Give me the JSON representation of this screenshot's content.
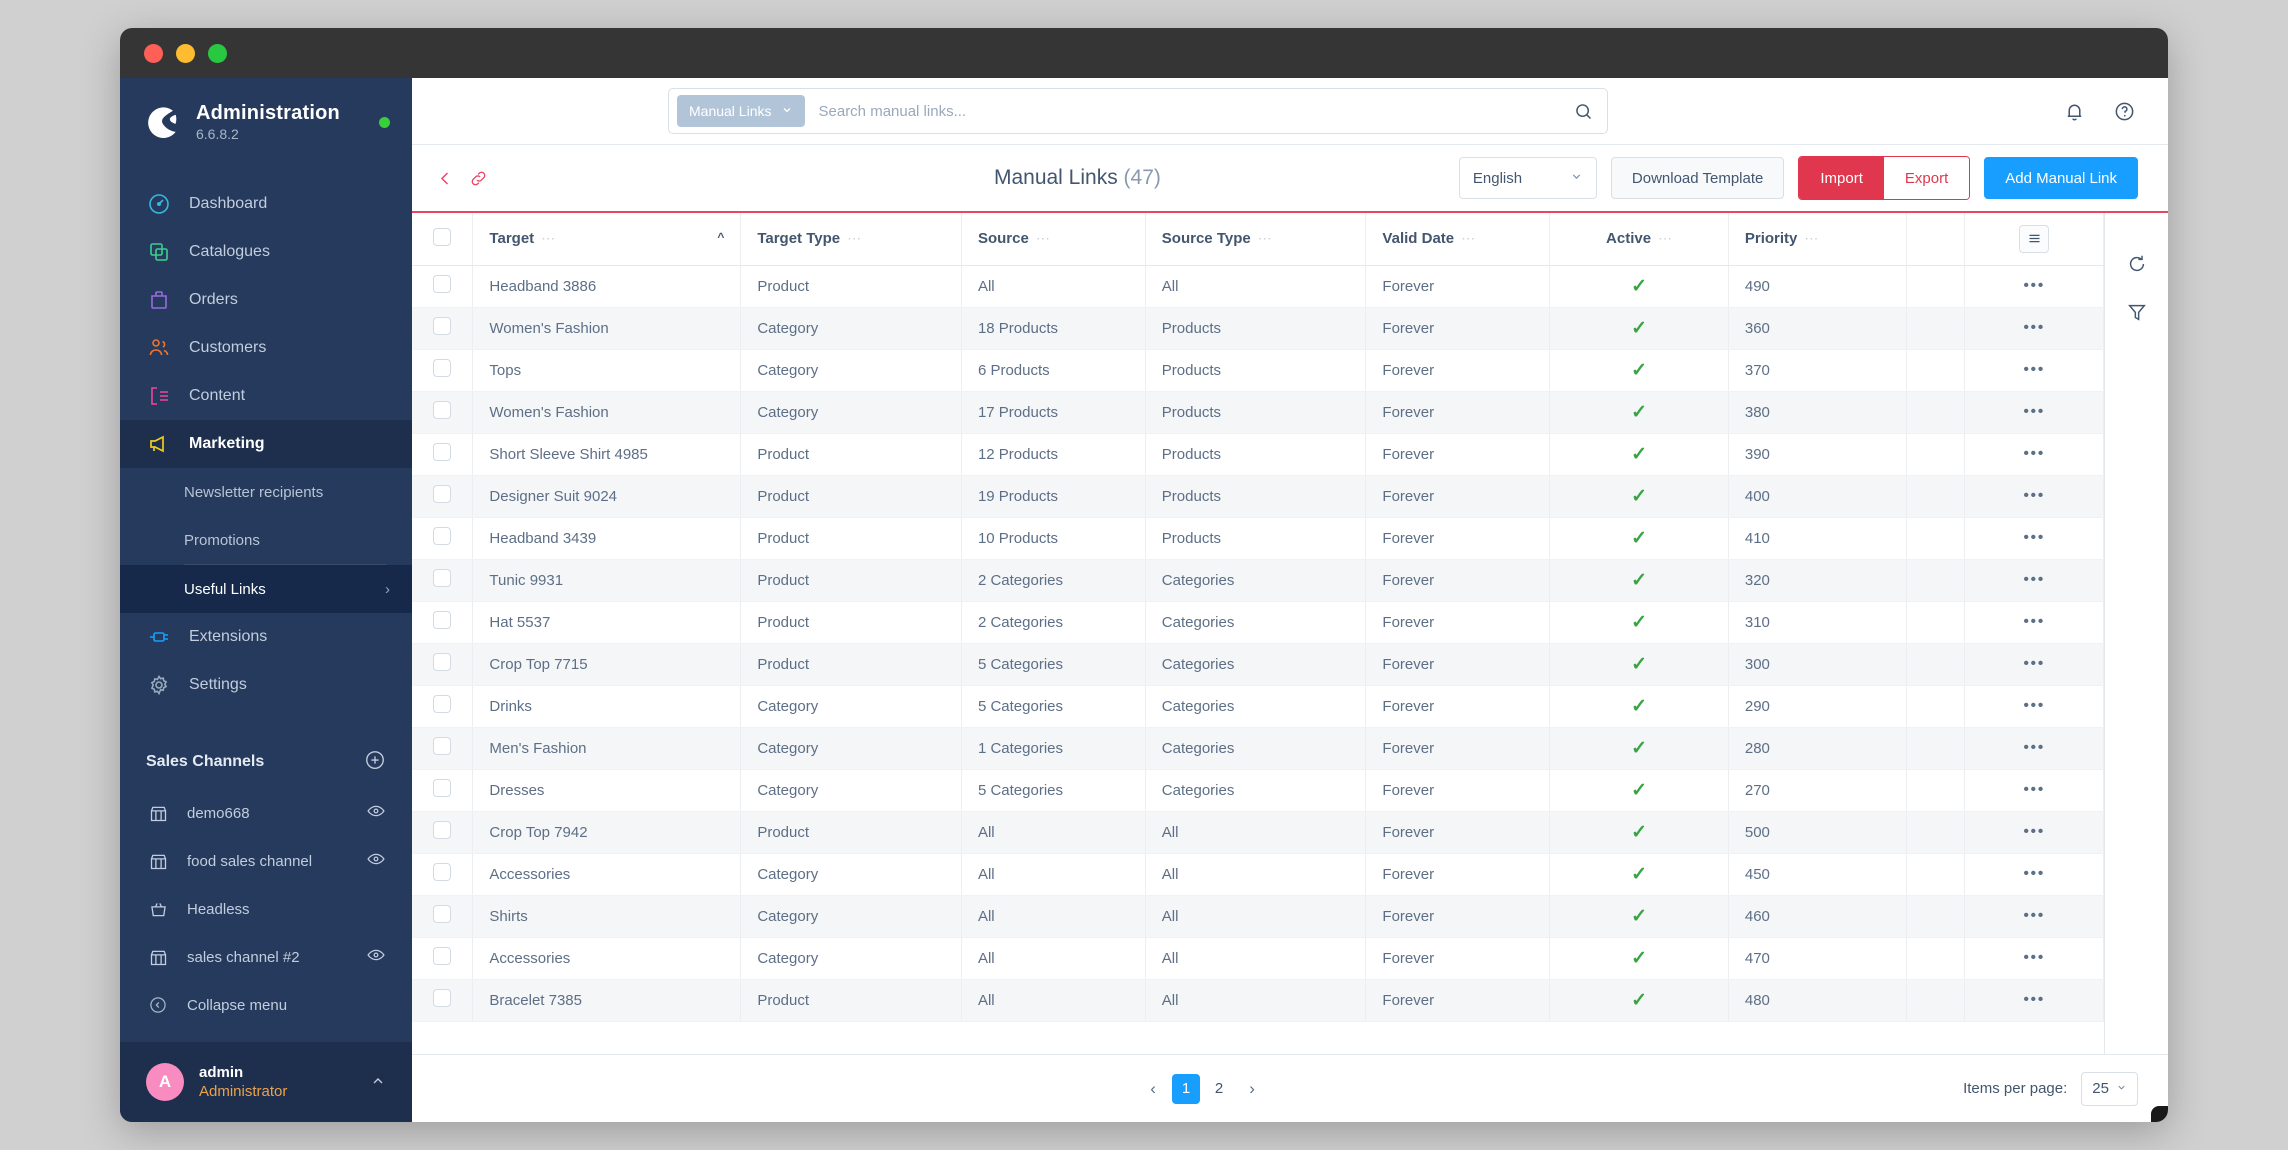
{
  "window": {
    "titlebar_dots": [
      "red",
      "yellow",
      "green"
    ]
  },
  "sidebar": {
    "brand": {
      "title": "Administration",
      "version": "6.6.8.2",
      "status_color": "#37d039"
    },
    "nav": [
      {
        "label": "Dashboard",
        "icon": "dashboard-icon",
        "color": "#37b8e0",
        "active": false
      },
      {
        "label": "Catalogues",
        "icon": "catalogues-icon",
        "color": "#3ecf8e",
        "active": false
      },
      {
        "label": "Orders",
        "icon": "orders-icon",
        "color": "#9a6ae0",
        "active": false
      },
      {
        "label": "Customers",
        "icon": "customers-icon",
        "color": "#f2742c",
        "active": false
      },
      {
        "label": "Content",
        "icon": "content-icon",
        "color": "#f0449a",
        "active": false
      },
      {
        "label": "Marketing",
        "icon": "marketing-icon",
        "color": "#f0cd1e",
        "active": true
      }
    ],
    "marketing_sub": [
      {
        "label": "Newsletter recipients",
        "selected": false
      },
      {
        "label": "Promotions",
        "selected": false
      },
      {
        "label": "Useful Links",
        "selected": true,
        "chevron": "›"
      }
    ],
    "nav_tail": [
      {
        "label": "Extensions",
        "icon": "extensions-icon",
        "color": "#189eff"
      },
      {
        "label": "Settings",
        "icon": "settings-icon",
        "color": "#9aaabf"
      }
    ],
    "sales_channels": {
      "heading": "Sales Channels",
      "add_label": "+",
      "items": [
        {
          "label": "demo668",
          "icon": "storefront-icon",
          "eye": true
        },
        {
          "label": "food sales channel",
          "icon": "storefront-icon",
          "eye": true
        },
        {
          "label": "Headless",
          "icon": "headless-icon",
          "eye": false
        },
        {
          "label": "sales channel #2",
          "icon": "storefront-icon",
          "eye": true
        }
      ]
    },
    "collapse": {
      "label": "Collapse menu",
      "icon": "collapse-icon"
    },
    "user": {
      "initial": "A",
      "name": "admin",
      "role": "Administrator"
    }
  },
  "topbar": {
    "search_scope": "Manual Links",
    "search_placeholder": "Search manual links...",
    "search_value": "",
    "search_icon": "search-icon",
    "notification_icon": "bell-icon",
    "help_icon": "help-icon"
  },
  "smartbar": {
    "back_icon": "chevron-left-icon",
    "link_icon": "link-icon",
    "title": "Manual Links",
    "count": "(47)",
    "language": "English",
    "download_template": "Download Template",
    "import": "Import",
    "export": "Export",
    "add": "Add Manual Link",
    "accent_color": "#e94561",
    "primary_color": "#189eff"
  },
  "table": {
    "columns": [
      {
        "label": "Target",
        "sorted": "asc"
      },
      {
        "label": "Target Type",
        "sorted": ""
      },
      {
        "label": "Source",
        "sorted": ""
      },
      {
        "label": "Source Type",
        "sorted": ""
      },
      {
        "label": "Valid Date",
        "sorted": ""
      },
      {
        "label": "Active",
        "sorted": ""
      },
      {
        "label": "Priority",
        "sorted": ""
      }
    ],
    "rows": [
      {
        "target": "Headband 3886",
        "target_type": "Product",
        "source": "All",
        "source_type": "All",
        "valid_date": "Forever",
        "active": true,
        "priority": "490"
      },
      {
        "target": "Women's Fashion",
        "target_type": "Category",
        "source": "18 Products",
        "source_type": "Products",
        "valid_date": "Forever",
        "active": true,
        "priority": "360"
      },
      {
        "target": "Tops",
        "target_type": "Category",
        "source": "6 Products",
        "source_type": "Products",
        "valid_date": "Forever",
        "active": true,
        "priority": "370"
      },
      {
        "target": "Women's Fashion",
        "target_type": "Category",
        "source": "17 Products",
        "source_type": "Products",
        "valid_date": "Forever",
        "active": true,
        "priority": "380"
      },
      {
        "target": "Short Sleeve Shirt 4985",
        "target_type": "Product",
        "source": "12 Products",
        "source_type": "Products",
        "valid_date": "Forever",
        "active": true,
        "priority": "390"
      },
      {
        "target": "Designer Suit 9024",
        "target_type": "Product",
        "source": "19 Products",
        "source_type": "Products",
        "valid_date": "Forever",
        "active": true,
        "priority": "400"
      },
      {
        "target": "Headband 3439",
        "target_type": "Product",
        "source": "10 Products",
        "source_type": "Products",
        "valid_date": "Forever",
        "active": true,
        "priority": "410"
      },
      {
        "target": "Tunic 9931",
        "target_type": "Product",
        "source": "2 Categories",
        "source_type": "Categories",
        "valid_date": "Forever",
        "active": true,
        "priority": "320"
      },
      {
        "target": "Hat 5537",
        "target_type": "Product",
        "source": "2 Categories",
        "source_type": "Categories",
        "valid_date": "Forever",
        "active": true,
        "priority": "310"
      },
      {
        "target": "Crop Top 7715",
        "target_type": "Product",
        "source": "5 Categories",
        "source_type": "Categories",
        "valid_date": "Forever",
        "active": true,
        "priority": "300"
      },
      {
        "target": "Drinks",
        "target_type": "Category",
        "source": "5 Categories",
        "source_type": "Categories",
        "valid_date": "Forever",
        "active": true,
        "priority": "290"
      },
      {
        "target": "Men's Fashion",
        "target_type": "Category",
        "source": "1 Categories",
        "source_type": "Categories",
        "valid_date": "Forever",
        "active": true,
        "priority": "280"
      },
      {
        "target": "Dresses",
        "target_type": "Category",
        "source": "5 Categories",
        "source_type": "Categories",
        "valid_date": "Forever",
        "active": true,
        "priority": "270"
      },
      {
        "target": "Crop Top 7942",
        "target_type": "Product",
        "source": "All",
        "source_type": "All",
        "valid_date": "Forever",
        "active": true,
        "priority": "500"
      },
      {
        "target": "Accessories",
        "target_type": "Category",
        "source": "All",
        "source_type": "All",
        "valid_date": "Forever",
        "active": true,
        "priority": "450"
      },
      {
        "target": "Shirts",
        "target_type": "Category",
        "source": "All",
        "source_type": "All",
        "valid_date": "Forever",
        "active": true,
        "priority": "460"
      },
      {
        "target": "Accessories",
        "target_type": "Category",
        "source": "All",
        "source_type": "All",
        "valid_date": "Forever",
        "active": true,
        "priority": "470"
      },
      {
        "target": "Bracelet 7385",
        "target_type": "Product",
        "source": "All",
        "source_type": "All",
        "valid_date": "Forever",
        "active": true,
        "priority": "480"
      }
    ],
    "context_glyph": "•••",
    "check_glyph": "✓",
    "active_check_color": "#37a543"
  },
  "rail": {
    "refresh_icon": "refresh-icon",
    "filter_icon": "filter-icon"
  },
  "pagination": {
    "prev": "‹",
    "next": "›",
    "pages": [
      "1",
      "2"
    ],
    "current": "1",
    "items_per_page_label": "Items per page:",
    "items_per_page_value": "25"
  },
  "symfony_badge": {
    "name": "symfony-toolbar-badge"
  }
}
